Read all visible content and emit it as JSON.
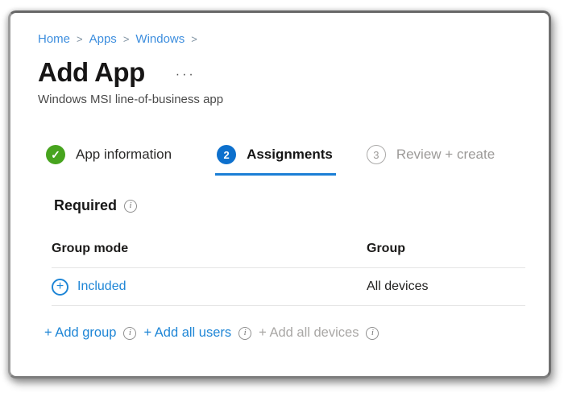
{
  "breadcrumb": {
    "separator": ">",
    "items": [
      {
        "label": "Home"
      },
      {
        "label": "Apps"
      },
      {
        "label": "Windows"
      }
    ]
  },
  "header": {
    "title": "Add App",
    "subtitle": "Windows MSI line-of-business app"
  },
  "steps": {
    "items": [
      {
        "label": "App information",
        "state": "complete"
      },
      {
        "label": "Assignments",
        "number": "2",
        "state": "active"
      },
      {
        "label": "Review + create",
        "number": "3",
        "state": "disabled"
      }
    ]
  },
  "section": {
    "title": "Required"
  },
  "table": {
    "columns": [
      "Group mode",
      "Group"
    ],
    "rows": [
      {
        "group_mode": "Included",
        "group": "All devices"
      }
    ]
  },
  "actions": {
    "items": [
      {
        "label": "+ Add group",
        "disabled": false
      },
      {
        "label": "+ Add all users",
        "disabled": false
      },
      {
        "label": "+ Add all devices",
        "disabled": true
      }
    ]
  },
  "icons": {
    "check": "✓",
    "info": "i",
    "plus": "+",
    "more": "···"
  },
  "colors": {
    "accent_blue": "#1f86d6",
    "breadcrumb_blue": "#3d8ede",
    "step_active_blue": "#0d70cd",
    "underline_blue": "#1b7fd6",
    "success_green": "#47a41e",
    "disabled_gray": "#9c9a98"
  }
}
